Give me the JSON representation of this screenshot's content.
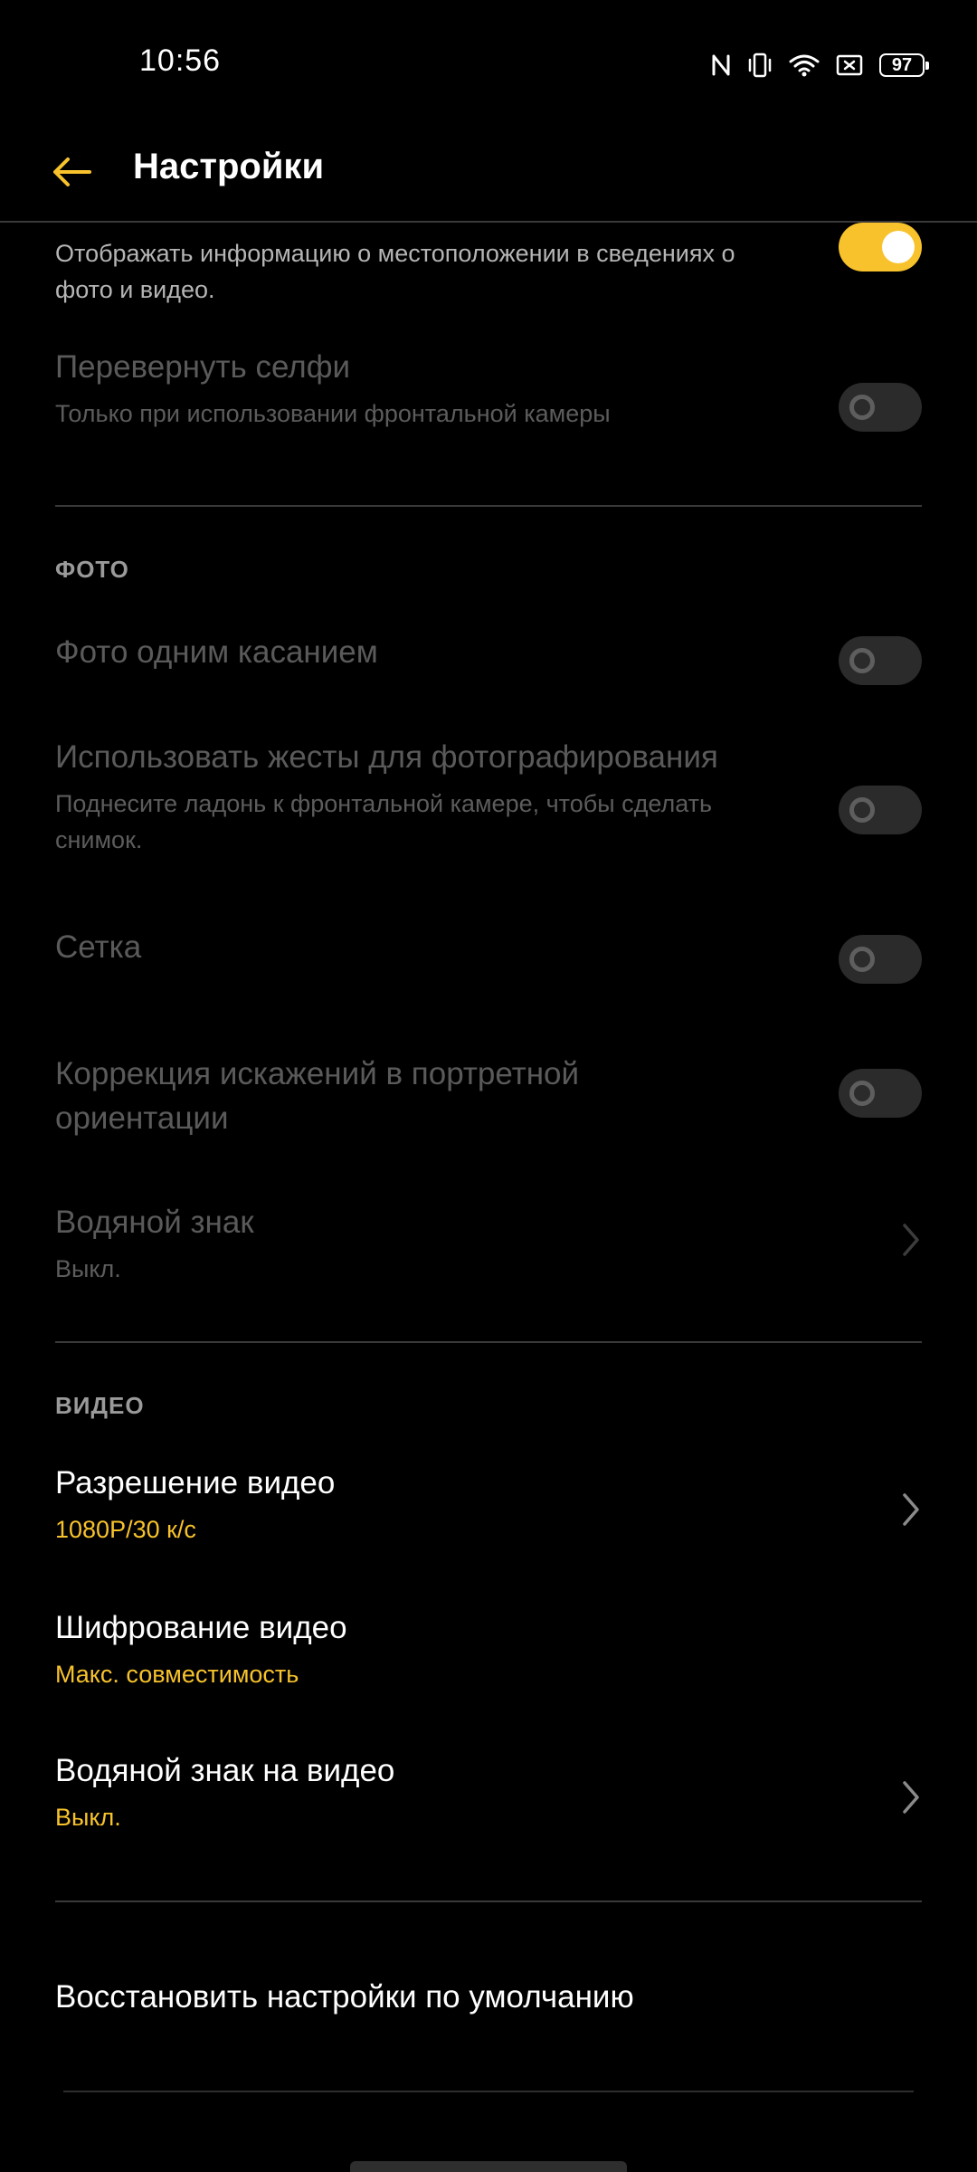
{
  "status_bar": {
    "time": "10:56",
    "battery": "97",
    "icons": [
      "nfc-icon",
      "vibrate-icon",
      "wifi-icon",
      "screen-record-icon",
      "battery-icon"
    ]
  },
  "app_bar": {
    "title": "Настройки",
    "back_icon": "arrow-left-icon"
  },
  "colors": {
    "accent": "#f7c22c",
    "background": "#000000",
    "divider": "#3a3a3a"
  },
  "location_row": {
    "subtitle": "Отображать информацию о местоположении в сведениях о фото и видео.",
    "toggle_on": true
  },
  "mirror_selfie": {
    "title": "Перевернуть селфи",
    "subtitle": "Только при использовании фронтальной камеры",
    "toggle_on": false
  },
  "photo_section": {
    "header": "ФОТО",
    "items": [
      {
        "title": "Фото одним касанием",
        "toggle_on": false
      },
      {
        "title": "Использовать жесты для фотографирования",
        "subtitle": "Поднесите ладонь к фронтальной камере, чтобы сделать снимок.",
        "toggle_on": false
      },
      {
        "title": "Сетка",
        "toggle_on": false
      },
      {
        "title": "Коррекция искажений в портретной ориентации",
        "toggle_on": false
      },
      {
        "title": "Водяной знак",
        "subtitle": "Выкл."
      }
    ]
  },
  "video_section": {
    "header": "ВИДЕО",
    "items": [
      {
        "title": "Разрешение видео",
        "value": "1080P/30 к/с"
      },
      {
        "title": "Шифрование видео",
        "value": "Макс. совместимость"
      },
      {
        "title": "Водяной знак на видео",
        "value": "Выкл."
      }
    ]
  },
  "reset": {
    "label": "Восстановить настройки по умолчанию"
  }
}
